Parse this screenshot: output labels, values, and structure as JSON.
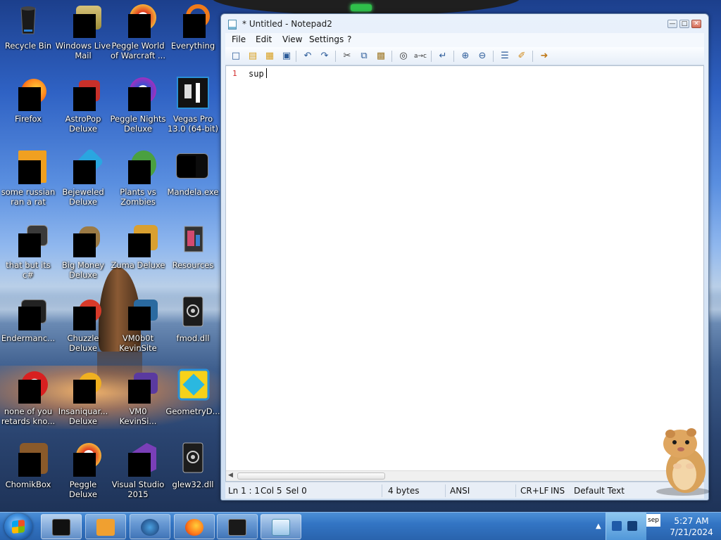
{
  "desktop": {
    "icons": [
      {
        "label": "Recycle Bin"
      },
      {
        "label": "Windows Live Mail"
      },
      {
        "label": "Peggle World of Warcraft ..."
      },
      {
        "label": "Everything"
      },
      {
        "label": "Firefox"
      },
      {
        "label": "AstroPop Deluxe"
      },
      {
        "label": "Peggle Nights Deluxe"
      },
      {
        "label": "Vegas Pro 13.0 (64-bit)"
      },
      {
        "label": "some russian ran a rat"
      },
      {
        "label": "Bejeweled Deluxe"
      },
      {
        "label": "Plants vs Zombies"
      },
      {
        "label": "Mandela.exe"
      },
      {
        "label": "that but its c#"
      },
      {
        "label": "Big Money Deluxe"
      },
      {
        "label": "Zuma Deluxe"
      },
      {
        "label": "Resources"
      },
      {
        "label": "Endermanc..."
      },
      {
        "label": "Chuzzle Deluxe"
      },
      {
        "label": "VM0b0t KevinSite"
      },
      {
        "label": "fmod.dll"
      },
      {
        "label": "none of you retards kno..."
      },
      {
        "label": "Insaniquar... Deluxe"
      },
      {
        "label": "VM0 KevinSi..."
      },
      {
        "label": "GeometryD..."
      },
      {
        "label": "ChomikBox"
      },
      {
        "label": "Peggle Deluxe"
      },
      {
        "label": "Visual Studio 2015"
      },
      {
        "label": "glew32.dll"
      }
    ]
  },
  "notepad": {
    "title": "* Untitled - Notepad2",
    "menu": [
      "File",
      "Edit",
      "View",
      "Settings",
      "?"
    ],
    "toolbar_icons": [
      "new-icon",
      "open-icon",
      "browse-icon",
      "save-icon",
      "undo-icon",
      "redo-icon",
      "cut-icon",
      "copy-icon",
      "paste-icon",
      "find-icon",
      "replace-icon",
      "word-wrap-icon",
      "zoom-in-icon",
      "zoom-out-icon",
      "scheme-icon",
      "customize-icon",
      "exit-icon"
    ],
    "line_number": "1",
    "content": "sup",
    "status": {
      "position": "Ln 1 : 1",
      "column": "Col 5",
      "selection": "Sel 0",
      "size": "4 bytes",
      "encoding": "ANSI",
      "line_ending": "CR+LF",
      "mode": "INS",
      "scheme": "Default Text"
    }
  },
  "taskbar": {
    "tray_note": "sep",
    "clock_time": "5:27 AM",
    "clock_date": "7/21/2024"
  },
  "colors": {
    "line_number": "#d12b2b",
    "taskbar": "#3375c4"
  }
}
